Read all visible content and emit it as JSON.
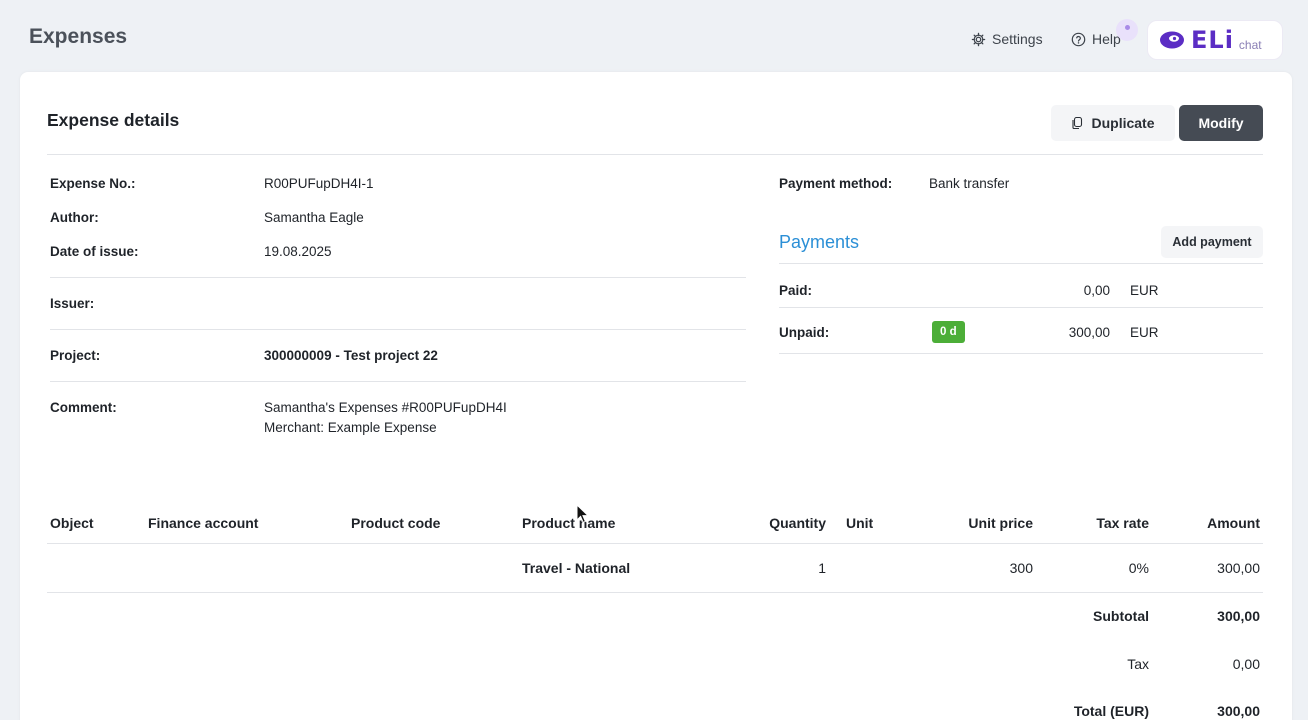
{
  "app": {
    "title": "Expenses",
    "settings_label": "Settings",
    "help_label": "Help",
    "chat_brand": "ELi",
    "chat_suffix": "chat"
  },
  "card": {
    "title": "Expense details",
    "duplicate_label": "Duplicate",
    "modify_label": "Modify"
  },
  "details": {
    "expense_no_label": "Expense No.:",
    "expense_no": "R00PUFupDH4I-1",
    "author_label": "Author:",
    "author": "Samantha Eagle",
    "date_label": "Date of issue:",
    "date": "19.08.2025",
    "issuer_label": "Issuer:",
    "issuer": "",
    "project_label": "Project:",
    "project": "300000009 - Test project 22",
    "comment_label": "Comment:",
    "comment_line1": "Samantha's Expenses #R00PUFupDH4I",
    "comment_line2": "Merchant: Example Expense"
  },
  "payment": {
    "method_label": "Payment method:",
    "method": "Bank transfer",
    "payments_title": "Payments",
    "add_payment_label": "Add payment",
    "paid_label": "Paid:",
    "paid_amount": "0,00",
    "paid_currency": "EUR",
    "unpaid_label": "Unpaid:",
    "unpaid_badge": "0 d",
    "unpaid_amount": "300,00",
    "unpaid_currency": "EUR"
  },
  "table": {
    "headers": {
      "object": "Object",
      "finance_account": "Finance account",
      "product_code": "Product code",
      "product_name": "Product name",
      "quantity": "Quantity",
      "unit": "Unit",
      "unit_price": "Unit price",
      "tax_rate": "Tax rate",
      "amount": "Amount"
    },
    "rows": [
      {
        "object": "",
        "finance_account": "",
        "product_code": "",
        "product_name": "Travel - National",
        "quantity": "1",
        "unit": "",
        "unit_price": "300",
        "tax_rate": "0%",
        "amount": "300,00"
      }
    ],
    "summary": {
      "subtotal_label": "Subtotal",
      "subtotal": "300,00",
      "tax_label": "Tax",
      "tax": "0,00",
      "total_label": "Total (EUR)",
      "total": "300,00"
    }
  },
  "colors": {
    "accent": "#2b8fd6",
    "primary_button": "#454b54",
    "badge_green": "#4cae38",
    "brand_purple": "#5b2dc4"
  },
  "icons": [
    "gear-icon",
    "help-circle-icon",
    "copy-icon",
    "chat-bubble-icon",
    "mouse-cursor-icon"
  ]
}
